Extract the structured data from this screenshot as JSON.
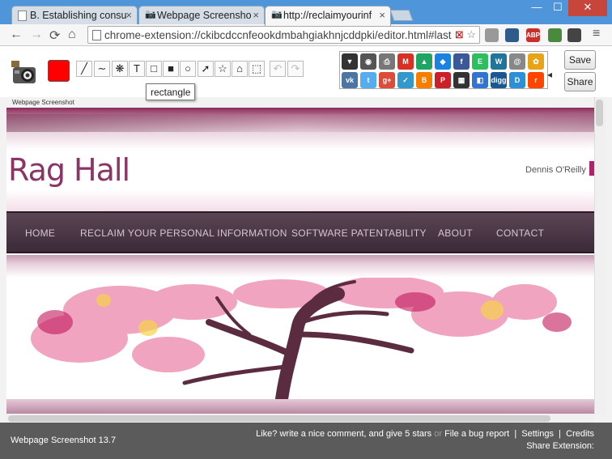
{
  "browser": {
    "tabs": [
      {
        "title": "B. Establishing consu",
        "active": false,
        "icon": "page-icon"
      },
      {
        "title": "Webpage Screensho",
        "active": false,
        "icon": "camera-icon"
      },
      {
        "title": "http://reclaimyourinf",
        "active": true,
        "icon": "camera-icon"
      }
    ],
    "url": "chrome-extension://ckibcdccnfeookdmbahgiakhnjcddpki/editor.html#last",
    "extensions": [
      {
        "name": "profile-ext",
        "label": "",
        "color": "#999999"
      },
      {
        "name": "avatar-ext",
        "label": "",
        "color": "#2e5c8a"
      },
      {
        "name": "adblock-ext",
        "label": "ABP",
        "color": "#c9302c"
      },
      {
        "name": "clipper-ext",
        "label": "",
        "color": "#4a8a3c"
      },
      {
        "name": "camera-ext",
        "label": "",
        "color": "#444444"
      }
    ]
  },
  "toolbar": {
    "color": "#ff0000",
    "tools": [
      {
        "name": "line-tool",
        "glyph": "╱"
      },
      {
        "name": "curve-tool",
        "glyph": "∼"
      },
      {
        "name": "blur-tool",
        "glyph": "❋"
      },
      {
        "name": "text-tool",
        "glyph": "T"
      },
      {
        "name": "rectangle-tool",
        "glyph": "□"
      },
      {
        "name": "filled-rectangle-tool",
        "glyph": "■"
      },
      {
        "name": "ellipse-tool",
        "glyph": "○"
      },
      {
        "name": "arrow-tool",
        "glyph": "➚"
      },
      {
        "name": "star-tool",
        "glyph": "☆"
      },
      {
        "name": "house-tool",
        "glyph": "⌂"
      },
      {
        "name": "crop-tool",
        "glyph": "⬚"
      }
    ],
    "undo_glyph": "↶",
    "redo_glyph": "↷",
    "tooltip": "rectangle",
    "save_label": "Save",
    "share_label": "Share"
  },
  "share_services": [
    {
      "name": "save-disk",
      "label": "▼",
      "color": "#333333"
    },
    {
      "name": "screenshot",
      "label": "◉",
      "color": "#555555"
    },
    {
      "name": "print",
      "label": "⎙",
      "color": "#777777"
    },
    {
      "name": "gmail",
      "label": "M",
      "color": "#d93025"
    },
    {
      "name": "google-drive",
      "label": "▲",
      "color": "#1fa463"
    },
    {
      "name": "dropbox",
      "label": "◆",
      "color": "#1a82e2"
    },
    {
      "name": "facebook",
      "label": "f",
      "color": "#3b5998"
    },
    {
      "name": "evernote",
      "label": "E",
      "color": "#2dbe60"
    },
    {
      "name": "wordpress",
      "label": "W",
      "color": "#21759b"
    },
    {
      "name": "email",
      "label": "@",
      "color": "#888888"
    },
    {
      "name": "picasa",
      "label": "✿",
      "color": "#e8a317"
    },
    {
      "name": "vkontakte",
      "label": "vk",
      "color": "#4c75a3"
    },
    {
      "name": "twitter",
      "label": "t",
      "color": "#55acee"
    },
    {
      "name": "google-plus",
      "label": "g+",
      "color": "#dd4b39"
    },
    {
      "name": "delicious-like",
      "label": "✓",
      "color": "#3399cc"
    },
    {
      "name": "blogger",
      "label": "B",
      "color": "#f57d00"
    },
    {
      "name": "pinterest",
      "label": "P",
      "color": "#cb2027"
    },
    {
      "name": "qr-code",
      "label": "▦",
      "color": "#333333"
    },
    {
      "name": "delicious",
      "label": "◧",
      "color": "#3274d1"
    },
    {
      "name": "digg",
      "label": "digg",
      "color": "#1b5891"
    },
    {
      "name": "diigo",
      "label": "D",
      "color": "#2d8fd5"
    },
    {
      "name": "reddit",
      "label": "r",
      "color": "#ff4500"
    }
  ],
  "canvas": {
    "caption": "Webpage Screenshot",
    "site_title": "Rag Hall",
    "site_author": "Dennis O'Reilly",
    "nav_items": [
      "HOME",
      "RECLAIM YOUR PERSONAL INFORMATION",
      "SOFTWARE PATENTABILITY",
      "ABOUT",
      "CONTACT"
    ]
  },
  "status": {
    "version": "Webpage Screenshot 13.7",
    "like_text": "Like? write a nice comment, and give 5 stars",
    "or_text": "or",
    "bug_text": "File a bug report",
    "separator": "|",
    "settings": "Settings",
    "credits": "Credits",
    "share_extension": "Share Extension:"
  }
}
